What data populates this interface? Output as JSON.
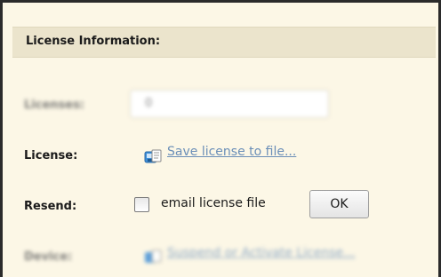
{
  "section": {
    "title": "License Information:"
  },
  "rows": {
    "licenses": {
      "label": "Licenses:",
      "value": "0"
    },
    "license": {
      "label": "License:",
      "link_text": "Save license to file...",
      "icon": "save-file-icon"
    },
    "resend": {
      "label": "Resend:",
      "checkbox_label": "email license file",
      "checked": false,
      "button_label": "OK"
    },
    "device": {
      "label": "Device:",
      "link_text": "Suspend or Activate License...",
      "icon": "device-icon"
    }
  },
  "colors": {
    "panel_background": "#fcf7e6",
    "header_background": "#ebe4cc",
    "link": "#6b8fb8",
    "border": "#2b2b2b"
  }
}
